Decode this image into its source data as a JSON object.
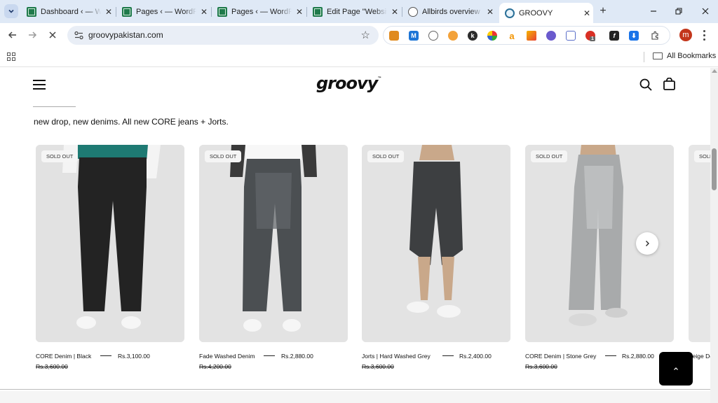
{
  "browser": {
    "tabs": [
      {
        "title": "Dashboard ‹ — WordPress",
        "icon": "wordpress-admin-icon"
      },
      {
        "title": "Pages ‹ — WordPress",
        "icon": "wordpress-admin-icon"
      },
      {
        "title": "Pages ‹ — WordPress",
        "icon": "wordpress-admin-icon"
      },
      {
        "title": "Edit Page \"Website\"",
        "icon": "wordpress-admin-icon"
      },
      {
        "title": "Allbirds overview and",
        "icon": "globe-icon"
      },
      {
        "title": "GROOVY",
        "icon": "groovy-favicon"
      }
    ],
    "new_tab": "+",
    "url": "groovypakistan.com",
    "profile_initial": "m",
    "extension_badge": "1",
    "all_bookmarks": "All Bookmarks"
  },
  "site": {
    "logo": "groovy",
    "logo_tm": "™",
    "section_title": "new drop, new denims. All new CORE jeans + Jorts."
  },
  "products": [
    {
      "badge": "SOLD OUT",
      "name": "CORE Denim | Black",
      "price": "Rs.3,100.00",
      "compare_at": "Rs.3,600.00"
    },
    {
      "badge": "SOLD OUT",
      "name": "Fade Washed Denim",
      "price": "Rs.2,880.00",
      "compare_at": "Rs.4,200.00"
    },
    {
      "badge": "SOLD OUT",
      "name": "Jorts | Hard Washed Grey",
      "price": "Rs.2,400.00",
      "compare_at": "Rs.3,600.00"
    },
    {
      "badge": "SOLD OUT",
      "name": "CORE Denim | Stone Grey",
      "price": "Rs.2,880.00",
      "compare_at": "Rs.3,600.00"
    },
    {
      "badge": "SOLD OUT",
      "name": "Beige Denim",
      "price": "",
      "compare_at": ""
    }
  ],
  "colors": {
    "tabbar": "#dfe9f6",
    "accent_profile": "#c3361b",
    "text": "#111111"
  }
}
